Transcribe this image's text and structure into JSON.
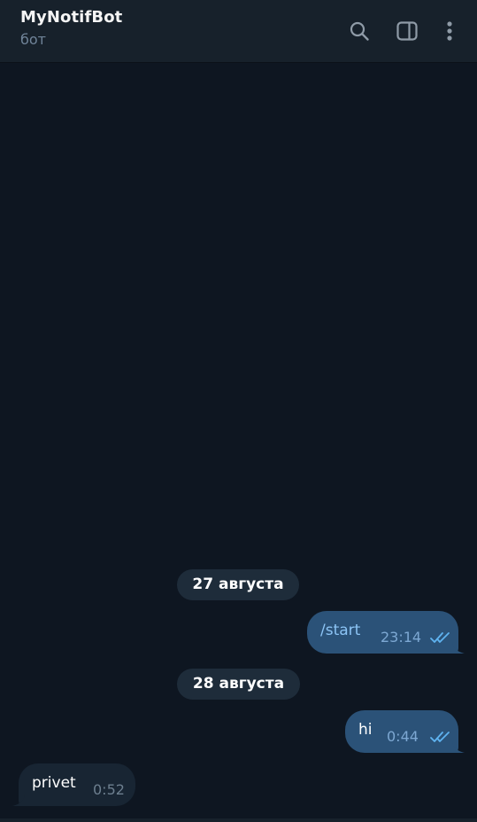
{
  "header": {
    "title": "MyNotifBot",
    "status": "бот",
    "icons": [
      "search-icon",
      "sidebar-toggle-icon",
      "more-vertical-icon"
    ]
  },
  "messages": [
    {
      "kind": "date",
      "text": "27 августа"
    },
    {
      "kind": "outgoing",
      "text": "/start",
      "time": "23:14",
      "read": true
    },
    {
      "kind": "date",
      "text": "28 августа"
    },
    {
      "kind": "outgoing",
      "text": "hi",
      "time": "0:44",
      "read": true
    },
    {
      "kind": "incoming",
      "text": "privet",
      "time": "0:52"
    }
  ],
  "colors": {
    "background": "#0e1621",
    "header": "#17212b",
    "outgoing_bubble": "#2b5278",
    "incoming_bubble": "#182533",
    "date_pill": "#1e2c3a",
    "read_checks": "#5fb3f0"
  }
}
